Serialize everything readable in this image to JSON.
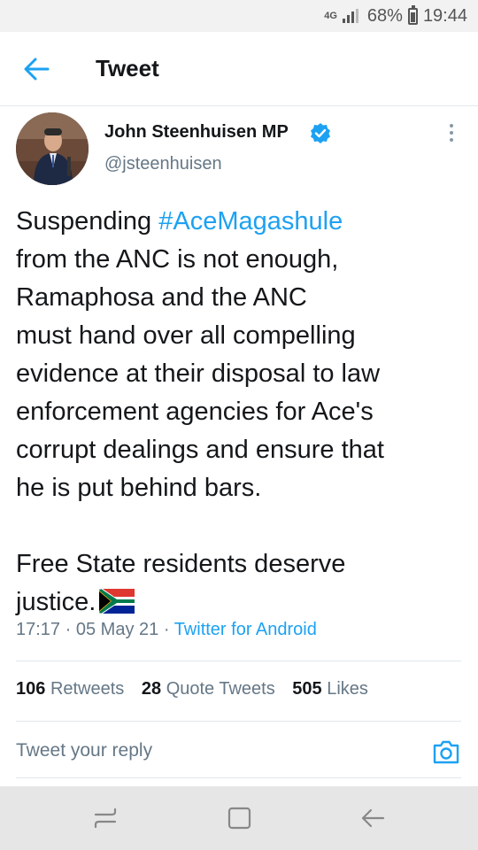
{
  "status_bar": {
    "network": "4G",
    "battery": "68%",
    "time": "19:44"
  },
  "header": {
    "title": "Tweet",
    "back_icon": "arrow-left-icon"
  },
  "tweet": {
    "author_name": "John Steenhuisen MP",
    "author_handle": "@jsteenhuisen",
    "verified_icon": "verified-badge-icon",
    "text": {
      "l1_pre": "Suspending ",
      "l1_hashtag": "#AceMagashule",
      "l2": "from the ANC is not enough,",
      "l3": "Ramaphosa and the ANC",
      "l4": "must hand over all compelling",
      "l5": "evidence at their disposal to law",
      "l6": "enforcement agencies for Ace's",
      "l7": "corrupt dealings and ensure that",
      "l8": "he is put behind bars.",
      "l9": "Free State residents deserve",
      "l10": "justice."
    },
    "emoji": "south-africa-flag",
    "time": "17:17",
    "separator": "·",
    "date": "05 May 21",
    "source": "Twitter for Android"
  },
  "stats": {
    "retweets_count": "106",
    "retweets_label": "Retweets",
    "quotes_count": "28",
    "quotes_label": "Quote Tweets",
    "likes_count": "505",
    "likes_label": "Likes"
  },
  "reply": {
    "placeholder": "Tweet your reply",
    "camera_icon": "camera-icon"
  },
  "colors": {
    "accent": "#1da1f2",
    "text": "#14171a",
    "secondary": "#657786",
    "divider": "#e1e8ed"
  }
}
